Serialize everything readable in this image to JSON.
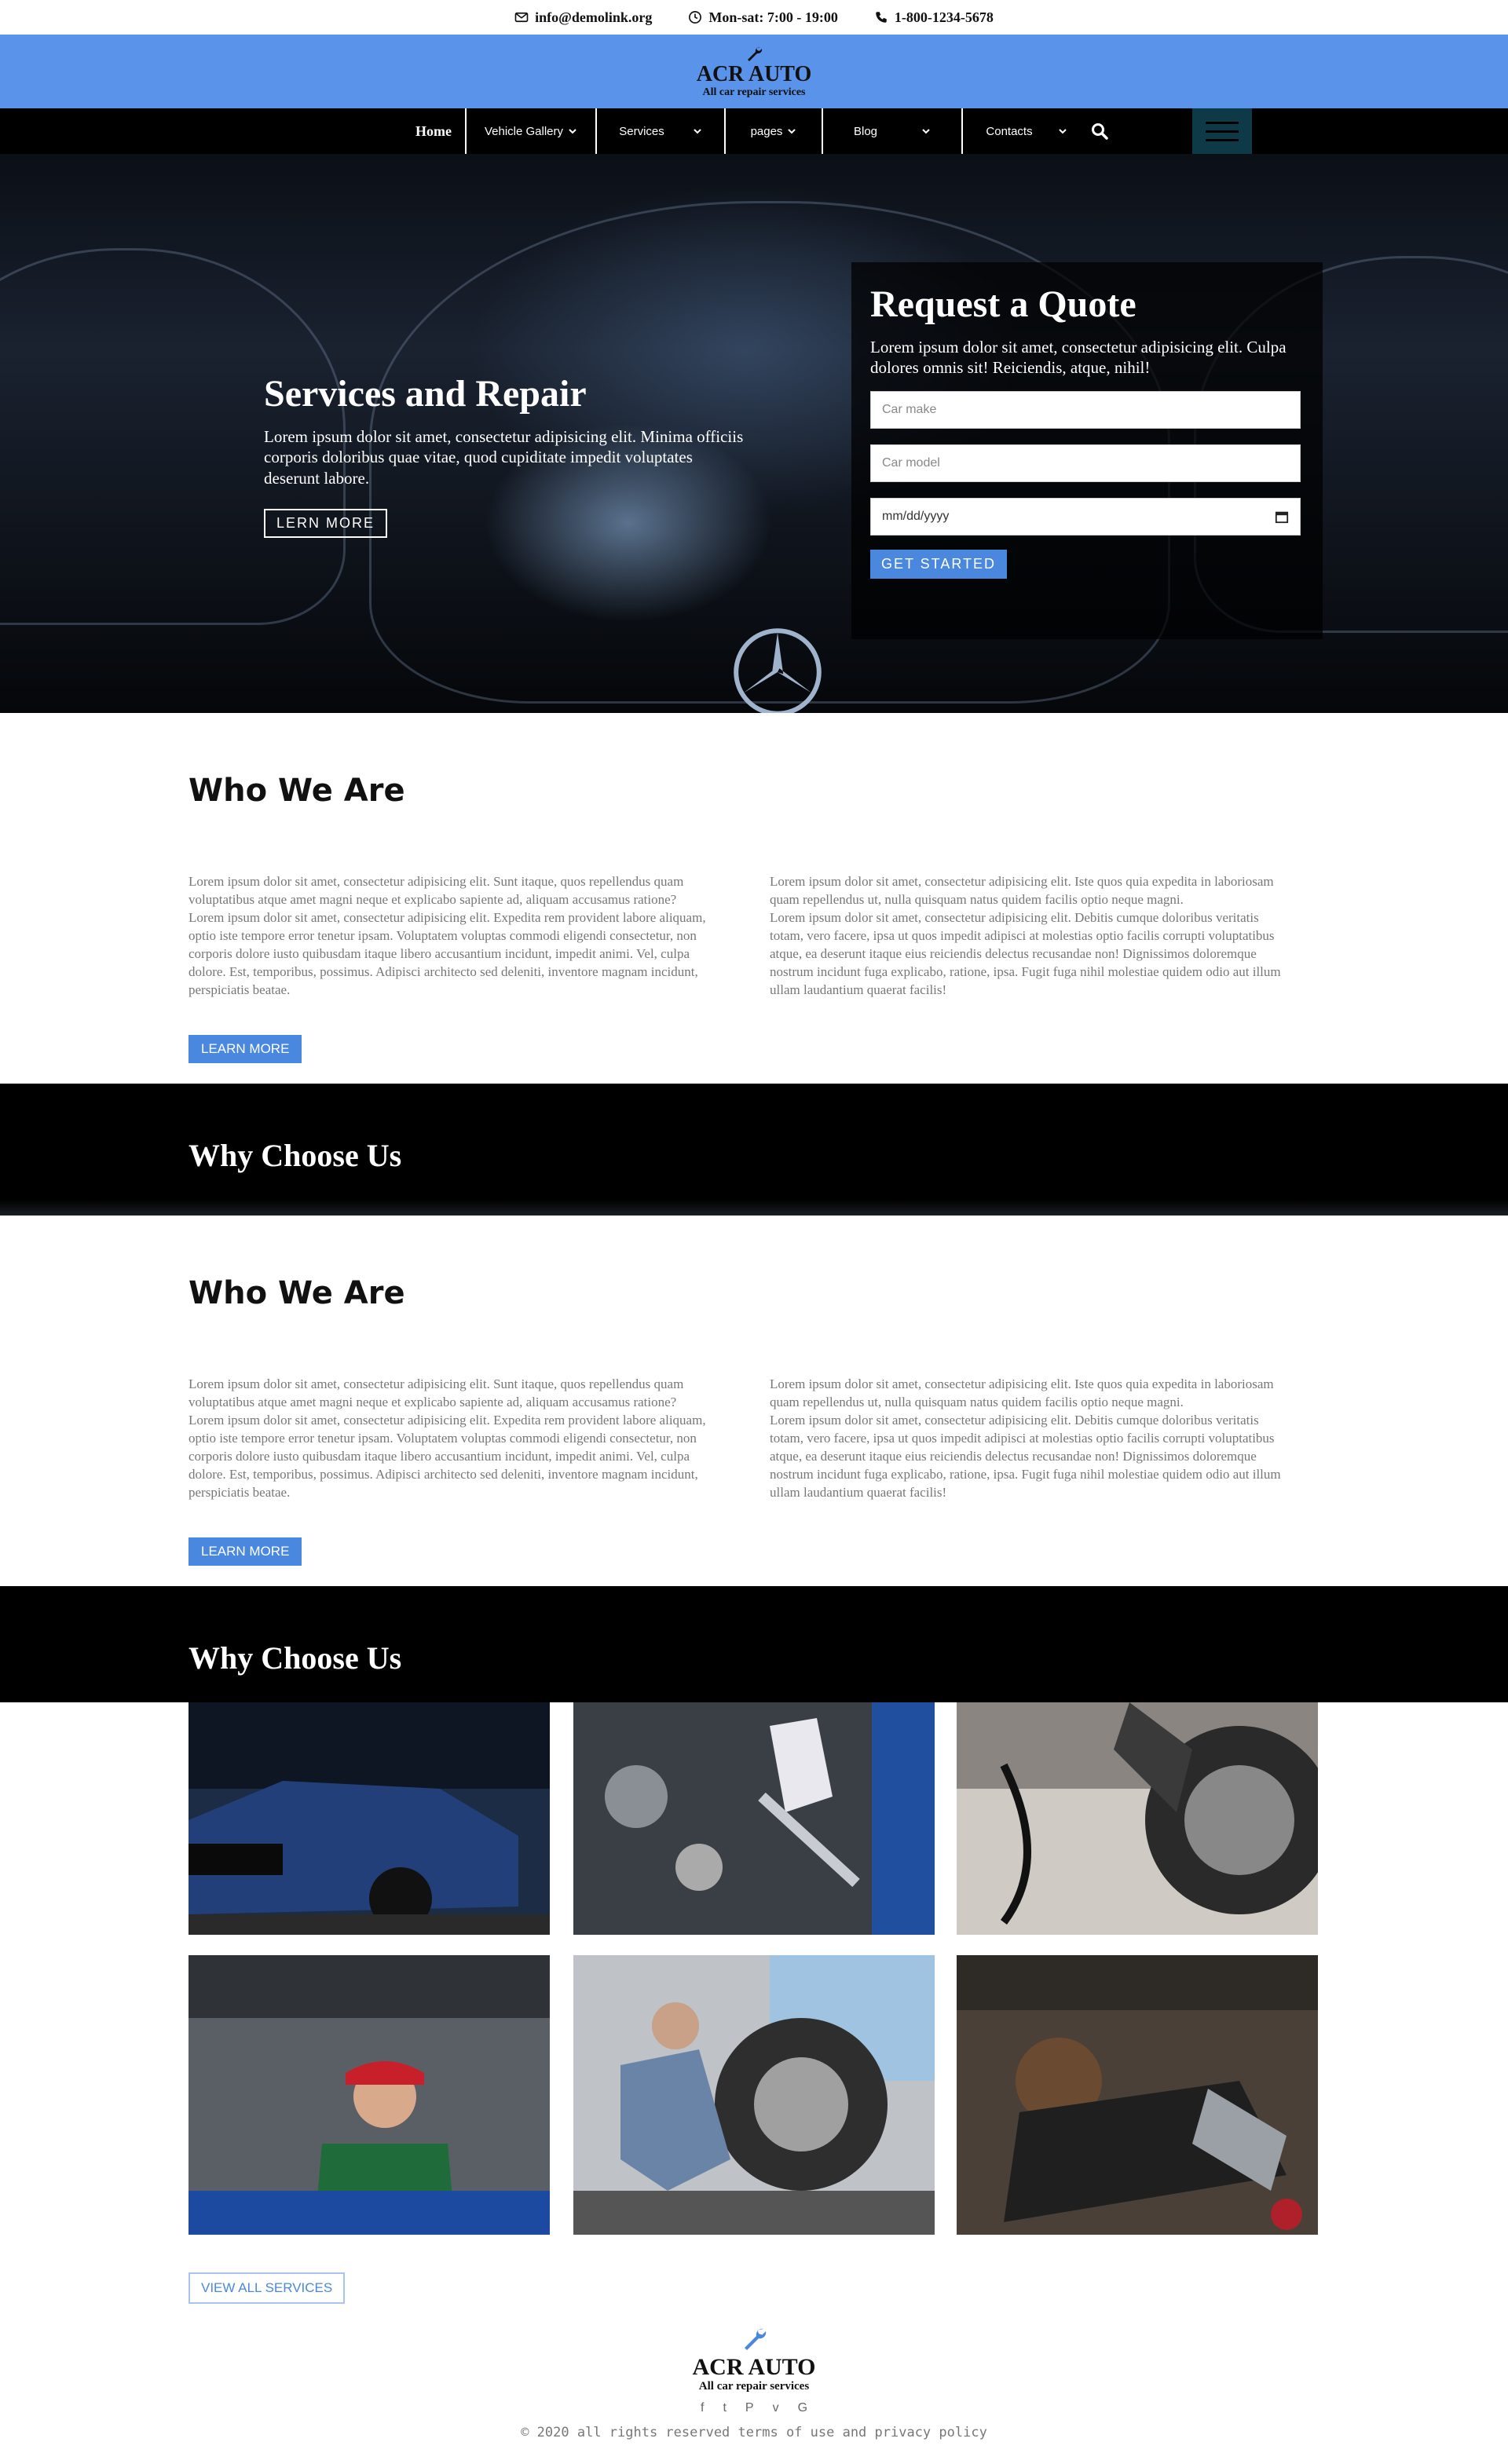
{
  "topbar": {
    "email": "info@demolink.org",
    "hours": "Mon-sat: 7:00 - 19:00",
    "phone": "1-800-1234-5678"
  },
  "brand": {
    "name": "ACR AUTO",
    "tagline": "All car repair services",
    "color": "#5a93ea"
  },
  "nav": {
    "items": [
      {
        "label": "Home"
      },
      {
        "label": "Vehicle Gallery"
      },
      {
        "label": "Services"
      },
      {
        "label": "pages"
      },
      {
        "label": "Blog"
      },
      {
        "label": "Contacts"
      }
    ],
    "search_icon": "search-icon",
    "menu_icon": "hamburger-icon"
  },
  "hero": {
    "title": "Services and Repair",
    "text": "Lorem ipsum dolor sit amet, consectetur adipisicing elit. Minima officiis corporis doloribus quae vitae, quod cupiditate impedit voluptates deserunt labore.",
    "button": "LERN MORE"
  },
  "quote": {
    "title": "Request a Quote",
    "text": "Lorem ipsum dolor sit amet, consectetur adipisicing elit. Culpa dolores omnis sit! Reiciendis, atque, nihil!",
    "make_placeholder": "Car make",
    "model_placeholder": "Car model",
    "date_placeholder": "mm/dd/yyyy",
    "button": "GET STARTED"
  },
  "who": {
    "title": "Who We Are",
    "left_p1": "Lorem ipsum dolor sit amet, consectetur adipisicing elit. Sunt itaque, quos repellendus quam voluptatibus atque amet magni neque et explicabo sapiente ad, aliquam accusamus ratione?",
    "left_p2": "Lorem ipsum dolor sit amet, consectetur adipisicing elit. Expedita rem provident labore aliquam, optio iste tempore error tenetur ipsam. Voluptatem voluptas commodi eligendi consectetur, non corporis dolore iusto quibusdam itaque libero accusantium incidunt, impedit animi. Vel, culpa dolore. Est, temporibus, possimus. Adipisci architecto sed deleniti, inventore magnam incidunt, perspiciatis beatae.",
    "right_p1": "Lorem ipsum dolor sit amet, consectetur adipisicing elit. Iste quos quia expedita in laboriosam quam repellendus ut, nulla quisquam natus quidem facilis optio neque magni.",
    "right_p2": "Lorem ipsum dolor sit amet, consectetur adipisicing elit. Debitis cumque doloribus veritatis totam, vero facere, ipsa ut quos impedit adipisci at molestias optio facilis corrupti voluptatibus atque, ea deserunt itaque eius reiciendis delectus recusandae non! Dignissimos doloremque nostrum incidunt fuga explicabo, ratione, ipsa. Fugit fuga nihil molestiae quidem odio aut illum ullam laudantium quaerat facilis!",
    "button": "LEARN MORE"
  },
  "why": {
    "title": "Why Choose Us"
  },
  "gallery": {
    "button": "VIEW ALL SERVICES"
  },
  "footer": {
    "name": "ACR AUTO",
    "tagline": "All car repair services",
    "socials": [
      "f",
      "t",
      "P",
      "v",
      "G"
    ],
    "copyright": "© 2020 all rights reserved terms of use and privacy policy"
  }
}
